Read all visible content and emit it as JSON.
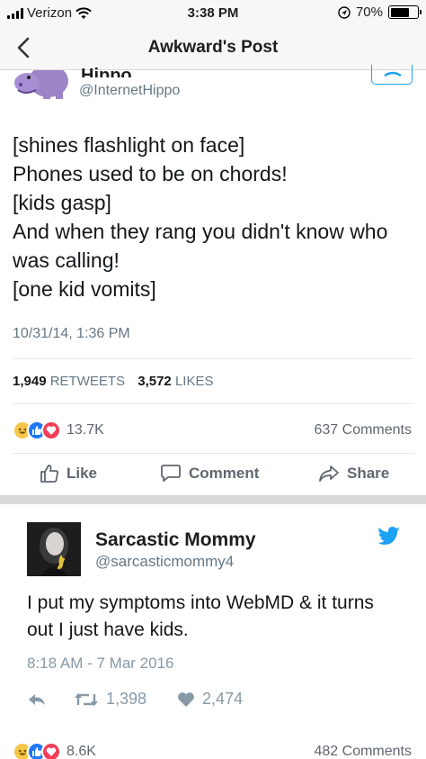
{
  "status_bar": {
    "carrier": "Verizon",
    "time": "3:38 PM",
    "battery": "70%",
    "battery_level": 0.7,
    "icons": [
      "signal-icon",
      "wifi-icon",
      "location-icon",
      "battery-icon"
    ]
  },
  "nav": {
    "title": "Awkward's Post",
    "back_icon": "chevron-left-icon"
  },
  "tweet1": {
    "name": "Hippo",
    "handle": "@InternetHippo",
    "lines": [
      "[shines flashlight on face]",
      "Phones used to be on chords!",
      "[kids gasp]",
      "And when they rang you didn't know who",
      "was calling!",
      "[one kid vomits]"
    ],
    "date": "10/31/14, 1:36 PM",
    "retweets": "1,949",
    "retweets_label": "RETWEETS",
    "likes": "3,572",
    "likes_label": "LIKES"
  },
  "post1": {
    "reactions_count": "13.7K",
    "comments": "637 Comments",
    "like_label": "Like",
    "comment_label": "Comment",
    "share_label": "Share"
  },
  "tweet2": {
    "name": "Sarcastic Mommy",
    "handle": "@sarcasticmommy4",
    "text": "I put my symptoms into WebMD & it turns out I just have kids.",
    "date": "8:18 AM - 7 Mar 2016",
    "retweets": "1,398",
    "likes": "2,474"
  },
  "post2": {
    "reactions_count": "8.6K",
    "comments": "482 Comments"
  },
  "colors": {
    "twitter_blue": "#1da1f2",
    "facebook_gray": "#606770",
    "like_blue": "#2078f4",
    "love_red": "#f33e58",
    "haha_yellow": "#f7c74c"
  }
}
